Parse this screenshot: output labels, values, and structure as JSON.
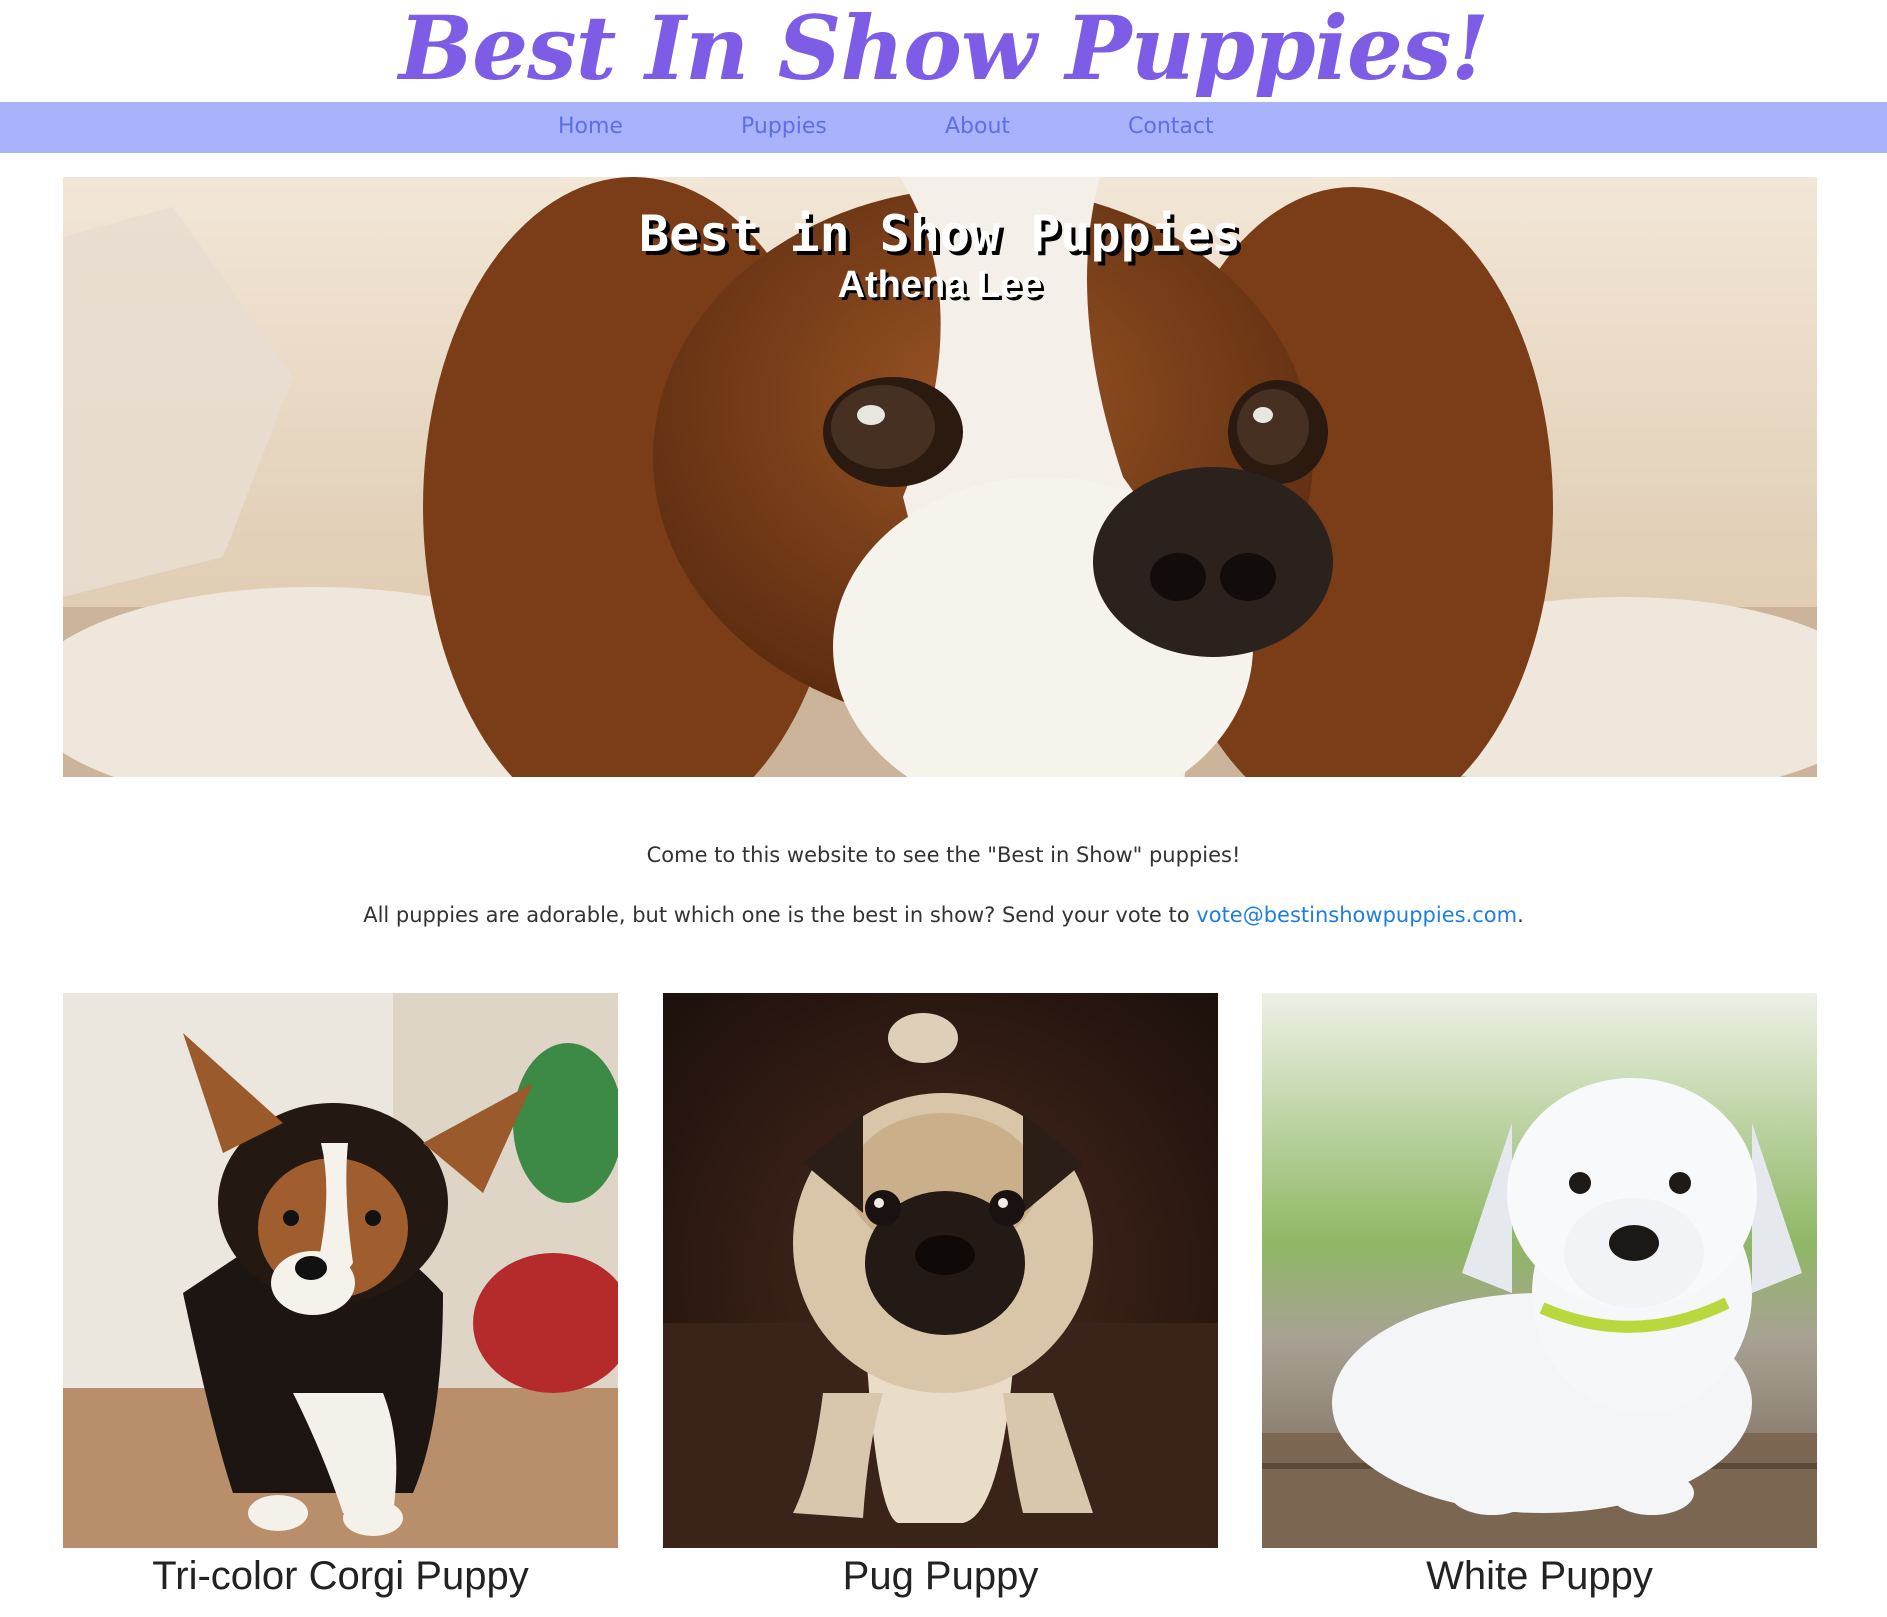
{
  "header": {
    "site_title": "Best In Show Puppies!"
  },
  "nav": {
    "items": [
      {
        "label": "Home"
      },
      {
        "label": "Puppies"
      },
      {
        "label": "About"
      },
      {
        "label": "Contact"
      }
    ]
  },
  "hero": {
    "title": "Best in Show Puppies",
    "subtitle": "Athena Lee",
    "image_subject": "Cavalier King Charles Spaniel puppy"
  },
  "intro": {
    "line1": "Come to this website to see the \"Best in Show\" puppies!",
    "line2_text": "All puppies are adorable, but which one is the best in show? Send your vote to ",
    "email": "vote@bestinshowpuppies.com",
    "line2_end": "."
  },
  "puppies": [
    {
      "name": "Tri-color Corgi Puppy"
    },
    {
      "name": "Pug Puppy"
    },
    {
      "name": "White Puppy"
    }
  ],
  "colors": {
    "brand_purple": "#7d5ce6",
    "nav_background": "#a9b3fc",
    "nav_link": "#5e6ee6",
    "link_blue": "#1e7fe0"
  }
}
